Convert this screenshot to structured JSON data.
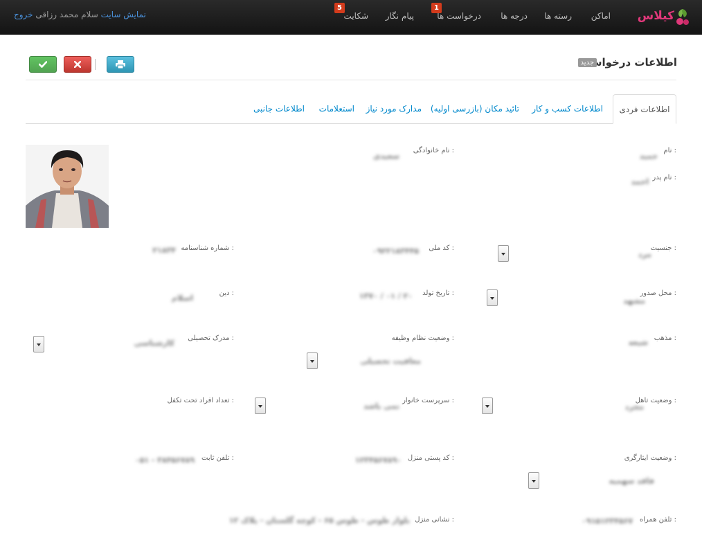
{
  "navbar": {
    "brand": "کیلاس",
    "items": [
      {
        "label": "اماکن"
      },
      {
        "label": "رسته ها"
      },
      {
        "label": "درجه ها"
      },
      {
        "label": "درخواست ها",
        "badge": "1"
      },
      {
        "label": "پیام نگار"
      },
      {
        "label": "شکایت",
        "badge": "5"
      }
    ],
    "user": {
      "logout": "خروج",
      "greeting": "سلام محمد رزاقی",
      "view_site": "نمایش سایت"
    }
  },
  "header": {
    "title": "اطلاعات درخواست",
    "status_badge": "جدید"
  },
  "tabs": [
    {
      "label": "اطلاعات فردی",
      "active": true
    },
    {
      "label": "اطلاعات کسب و کار"
    },
    {
      "label": "تائید مکان (بازرسی اولیه)"
    },
    {
      "label": "مدارک مورد نیاز"
    },
    {
      "label": "استعلامات"
    },
    {
      "label": "اطلاعات جانبی"
    }
  ],
  "form": {
    "first_name": {
      "label": "نام :",
      "value": "حمید"
    },
    "last_name": {
      "label": "نام خانوادگی :",
      "value": "سعیدی"
    },
    "father_name": {
      "label": "نام پدر :",
      "value": "احمد"
    },
    "gender": {
      "label": "جنسیت :",
      "value": "مرد"
    },
    "national_code": {
      "label": "کد ملی :",
      "value": "۰۹۲۲۱۸۳۴۴۵"
    },
    "id_number": {
      "label": "شماره شناسنامه :",
      "value": "۲۱۸۳۴"
    },
    "issue_place": {
      "label": "محل صدور :",
      "value": "مشهد"
    },
    "birth_date": {
      "label": "تاریخ تولد :",
      "value": "۱۳۷۰ / ۰۱ / ۲۰"
    },
    "religion": {
      "label": "دین :",
      "value": "اسلام"
    },
    "sect": {
      "label": "مذهب :",
      "value": "شیعه"
    },
    "military_status": {
      "label": "وضعیت نظام وظیفه :",
      "value": "معافیت تحصیلی"
    },
    "education": {
      "label": "مدرک تحصیلی :",
      "value": "کارشناسی"
    },
    "marital_status": {
      "label": "وضعیت تاهل :",
      "value": "مجرد"
    },
    "household_head": {
      "label": "سرپرست خانوار :",
      "value": "نمی باشد"
    },
    "dependents": {
      "label": "تعداد افراد تحت تکفل :",
      "value": ""
    },
    "residency_status": {
      "label": "وضعیت ایثارگری :",
      "value": "فاقد سهمیه"
    },
    "postal_code": {
      "label": "کد پستی منزل :",
      "value": "۱۲۳۴۵۶۷۸۹۰"
    },
    "phone": {
      "label": "تلفن ثابت :",
      "value": "۰۵۱ - ۳۸۴۵۶۷۸۹"
    },
    "mobile": {
      "label": "تلفن همراه :",
      "value": "۰۹۱۵۱۲۳۴۵۶۷"
    },
    "address": {
      "label": "نشانی منزل :",
      "value": "بلوار طوس - طوس ۶۵ - کوچه گلستان - پلاک ۱۲"
    }
  },
  "colors": {
    "navbar_bg": "#1b1b1b",
    "link": "#0088cc",
    "badge_red": "#d33b1c",
    "btn_print": "#2f96b4",
    "btn_cancel": "#bd362f",
    "btn_ok": "#51a351"
  },
  "icons": {
    "print": "printer-icon",
    "cancel": "close-icon",
    "ok": "check-icon"
  }
}
